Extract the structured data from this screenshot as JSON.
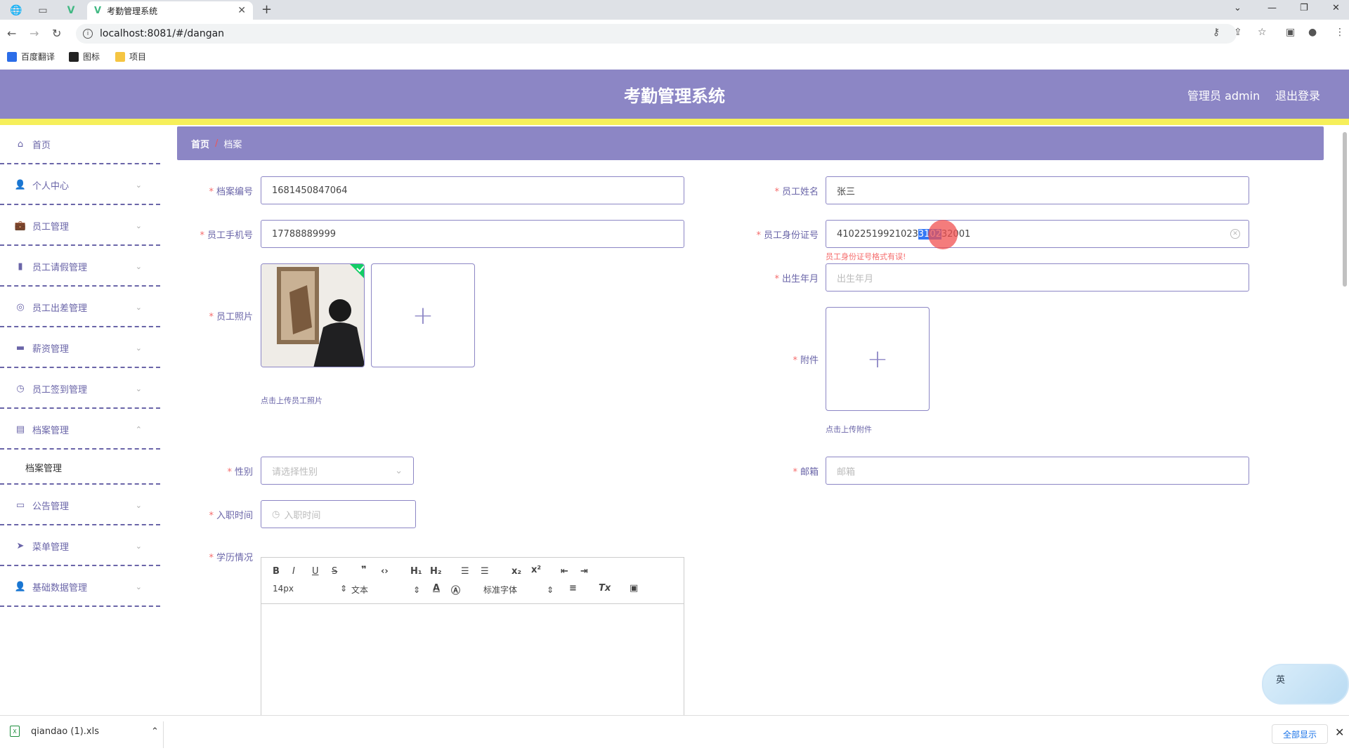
{
  "browser": {
    "tab_title": "考勤管理系统",
    "url": "localhost:8081/#/dangan",
    "bookmarks": [
      "百度翻译",
      "图标",
      "项目"
    ]
  },
  "header": {
    "title": "考勤管理系统",
    "user": "管理员 admin",
    "logout": "退出登录"
  },
  "sidebar": {
    "items": [
      {
        "label": "首页",
        "icon": "home-icon"
      },
      {
        "label": "个人中心",
        "icon": "user-icon"
      },
      {
        "label": "员工管理",
        "icon": "briefcase-icon"
      },
      {
        "label": "员工请假管理",
        "icon": "bar-chart-icon"
      },
      {
        "label": "员工出差管理",
        "icon": "globe-icon"
      },
      {
        "label": "薪资管理",
        "icon": "wallet-icon"
      },
      {
        "label": "员工签到管理",
        "icon": "clock-icon"
      },
      {
        "label": "档案管理",
        "icon": "document-icon"
      },
      {
        "label": "公告管理",
        "icon": "monitor-icon"
      },
      {
        "label": "菜单管理",
        "icon": "send-icon"
      },
      {
        "label": "基础数据管理",
        "icon": "user-icon"
      }
    ],
    "sub_item": "档案管理"
  },
  "breadcrumb": {
    "home": "首页",
    "sep": "/",
    "current": "档案"
  },
  "form": {
    "archive_no_label": "档案编号",
    "archive_no": "1681450847064",
    "name_label": "员工姓名",
    "name": "张三",
    "phone_label": "员工手机号",
    "phone": "17788889999",
    "id_label": "员工身份证号",
    "id_before": "41022519921023",
    "id_selected": "3102",
    "id_after": "32001",
    "id_error": "员工身份证号格式有误!",
    "birth_label": "出生年月",
    "birth_placeholder": "出生年月",
    "photo_label": "员工照片",
    "photo_hint": "点击上传员工照片",
    "attach_label": "附件",
    "attach_hint": "点击上传附件",
    "gender_label": "性别",
    "gender_placeholder": "请选择性别",
    "email_label": "邮箱",
    "email_placeholder": "邮箱",
    "join_label": "入职时间",
    "join_placeholder": "入职时间",
    "edu_label": "学历情况"
  },
  "editor": {
    "font_size": "14px",
    "format": "文本",
    "font": "标准字体"
  },
  "downloads": {
    "file": "qiandao (1).xls",
    "show_all": "全部显示"
  },
  "ime": {
    "lang": "英"
  },
  "colors": {
    "header": "#8c86c5",
    "accent_bar": "#f6ef5a",
    "label": "#6a65a8",
    "error": "#f56c6c"
  }
}
